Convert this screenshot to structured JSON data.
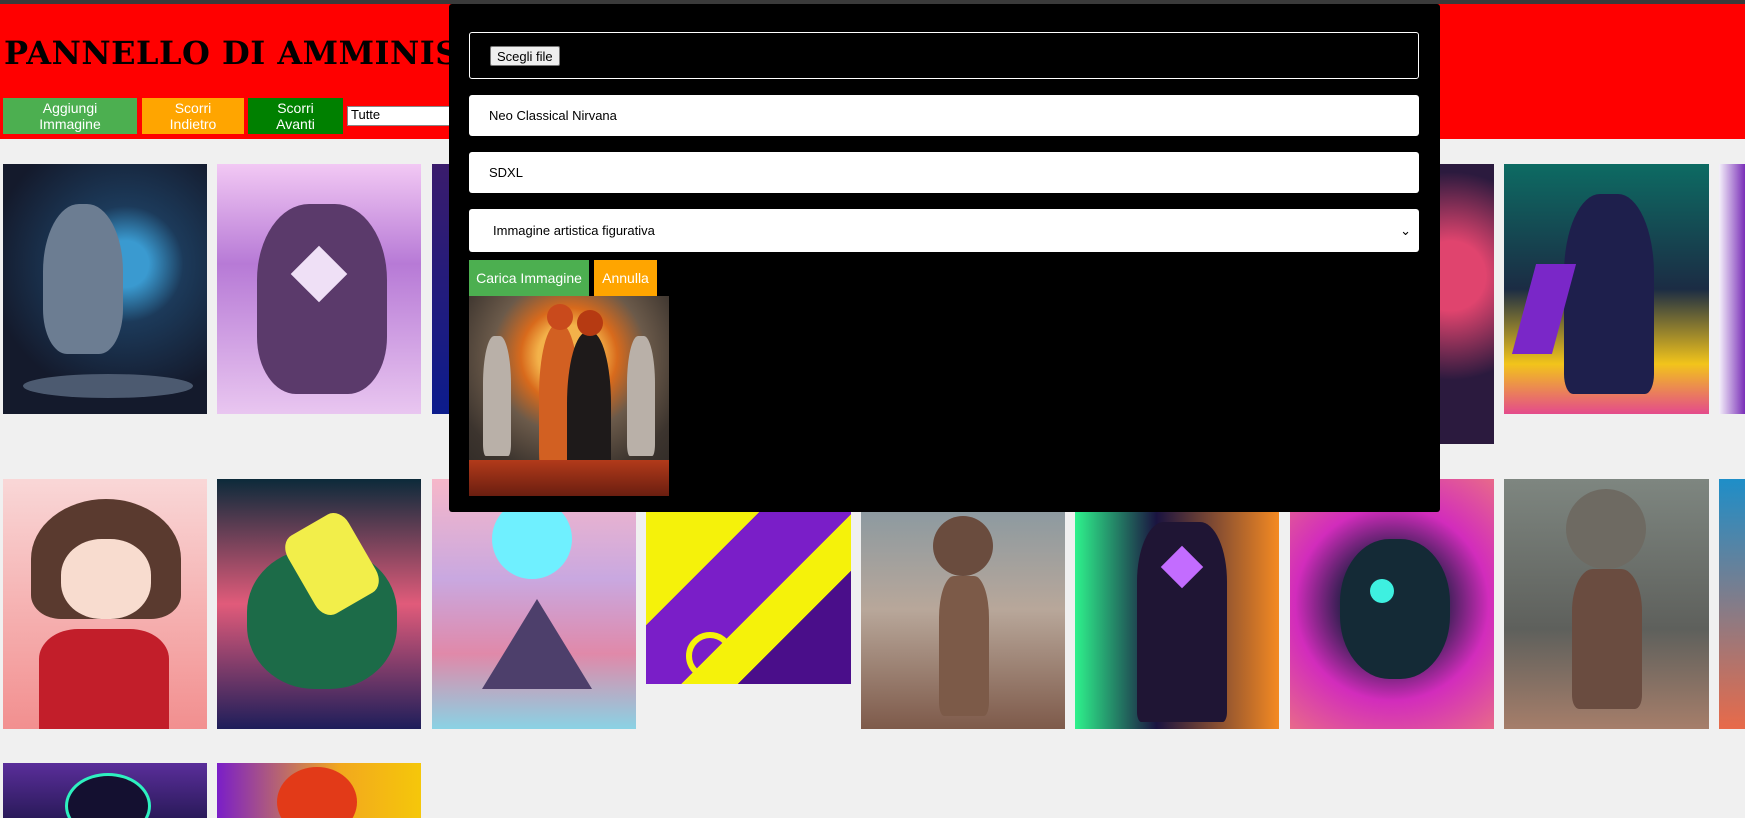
{
  "header": {
    "title": "PANNELLO DI AMMINISTRAZIONE",
    "add_button": "Aggiungi Immagine",
    "prev_button": "Scorri Indietro",
    "next_button": "Scorri Avanti",
    "filter_value": "Tutte"
  },
  "modal": {
    "file_button": "Scegli file",
    "name_value": "Neo Classical Nirvana",
    "model_value": "SDXL",
    "category_value": "Immagine artistica figurativa",
    "upload_button": "Carica Immagine",
    "cancel_button": "Annulla"
  },
  "colors": {
    "header_bg": "#ff0000",
    "add_button": "#4caf50",
    "prev_button": "#ffa500",
    "next_button": "#008000",
    "modal_bg": "#000000"
  }
}
